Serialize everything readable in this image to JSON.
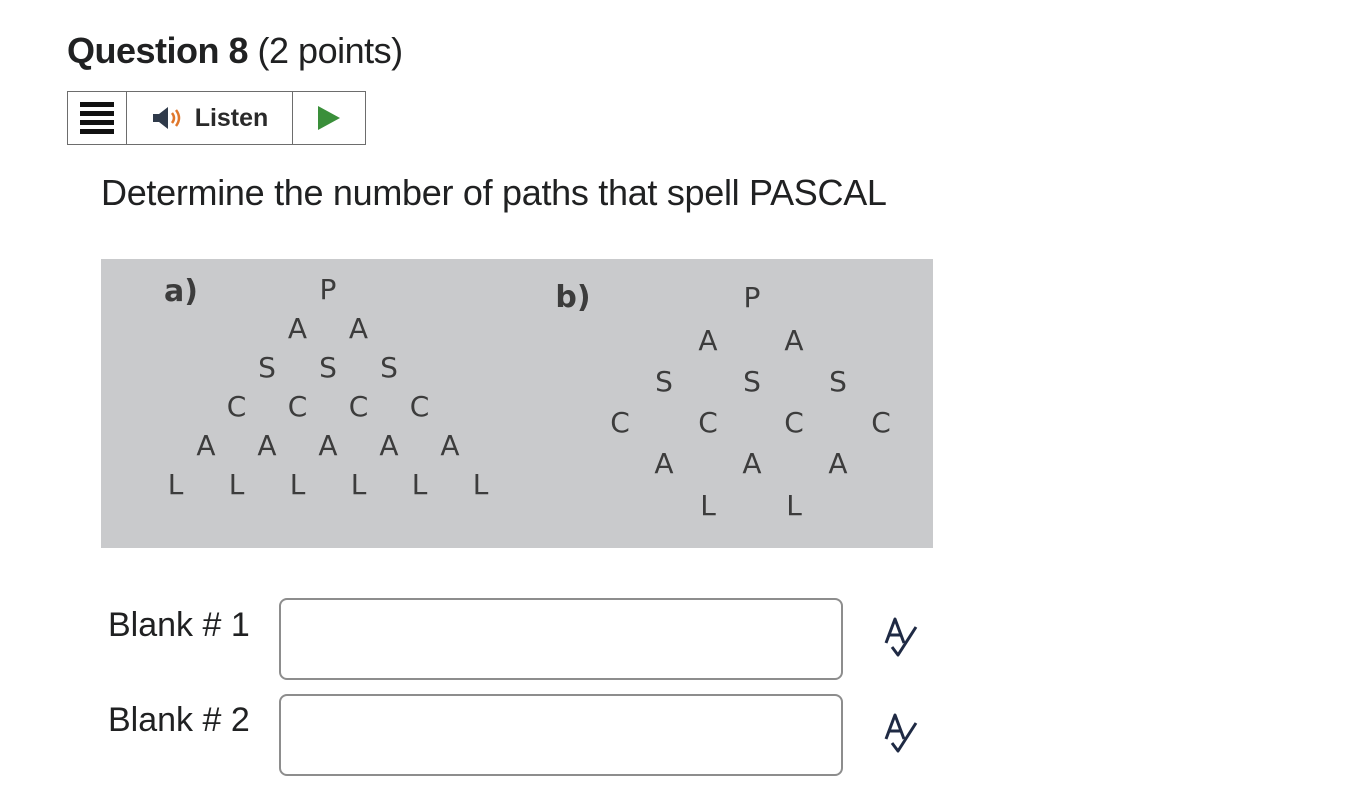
{
  "question": {
    "number_label": "Question 8",
    "points_label": "(2 points)"
  },
  "toolbar": {
    "menu_icon": "hamburger-icon",
    "listen_label": "Listen",
    "speaker_icon": "speaker-icon",
    "play_icon": "play-icon",
    "play_color": "#3a8f3a"
  },
  "prompt": "Determine the number of paths that spell PASCAL",
  "figure": {
    "panel_a": {
      "label": "a)",
      "rows": [
        [
          "P"
        ],
        [
          "A",
          "A"
        ],
        [
          "S",
          "S",
          "S"
        ],
        [
          "C",
          "C",
          "C",
          "C"
        ],
        [
          "A",
          "A",
          "A",
          "A",
          "A"
        ],
        [
          "L",
          "L",
          "L",
          "L",
          "L",
          "L"
        ]
      ]
    },
    "panel_b": {
      "label": "b)",
      "letters": [
        "P",
        "A",
        "A",
        "S",
        "S",
        "S",
        "C",
        "C",
        "C",
        "C",
        "A",
        "A",
        "A",
        "L",
        "L"
      ]
    }
  },
  "blanks": [
    {
      "label": "Blank # 1",
      "value": ""
    },
    {
      "label": "Blank # 2",
      "value": ""
    }
  ],
  "spellcheck_icon": "spellcheck-icon"
}
